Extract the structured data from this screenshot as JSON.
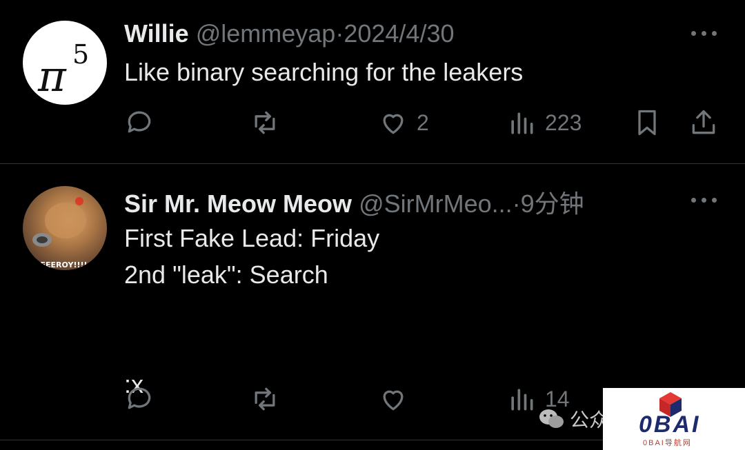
{
  "tweets": [
    {
      "avatar_alt": "π^5",
      "name": "Willie",
      "handle": "@lemmeyap",
      "separator": "·",
      "time": "2024/4/30",
      "text": "Like binary searching for the leakers",
      "likes": "2",
      "views": "223"
    },
    {
      "name": "Sir Mr. Meow Meow",
      "handle": "@SirMrMeo...",
      "separator": "·",
      "time": "9分钟",
      "text": "First Fake Lead: Friday\n2nd \"leak\": Search\n\n\n:x",
      "likes": "",
      "views": "14",
      "avatar_caption": "FEEEROY!!!!"
    }
  ],
  "watermark": {
    "label": "公众",
    "logo": "0BAI",
    "logo_sub": "0BAI导航网"
  },
  "colors": {
    "background": "#000000",
    "text": "#e7e9ea",
    "muted": "#71767b",
    "divider": "#2f3336"
  }
}
